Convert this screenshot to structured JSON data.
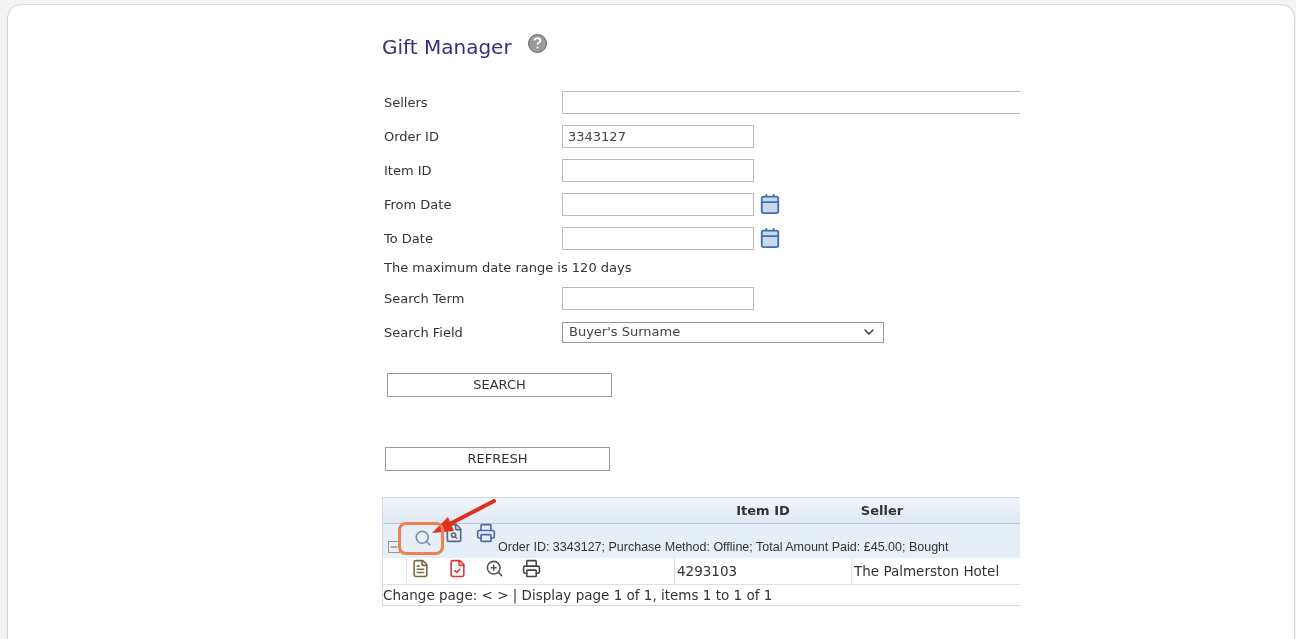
{
  "title": "Gift Manager",
  "fields": [
    {
      "kind": "wide",
      "label": "Sellers"
    },
    {
      "kind": "text",
      "label": "Order ID",
      "value": "3343127"
    },
    {
      "kind": "text",
      "label": "Item ID"
    },
    {
      "kind": "date",
      "label": "From Date"
    },
    {
      "kind": "date",
      "label": "To Date"
    },
    {
      "kind": "note",
      "label": "The maximum date range is 120 days"
    },
    {
      "kind": "text",
      "label": "Search Term"
    },
    {
      "kind": "select",
      "label": "Search Field",
      "value": "Buyer's Surname"
    }
  ],
  "search_button": "SEARCH",
  "refresh_button": "REFRESH",
  "table": {
    "columns": [
      "Item ID",
      "Seller"
    ],
    "group": {
      "expanded": true,
      "text": "Order ID: 3343127; Purchase Method: Offline; Total Amount Paid: £45.00; Bought"
    },
    "rows": [
      {
        "item_id": "4293103",
        "seller": "The Palmerston Hotel"
      }
    ],
    "footer": "Change page: < > | Display page 1 of 1, items 1 to 1 of 1"
  }
}
